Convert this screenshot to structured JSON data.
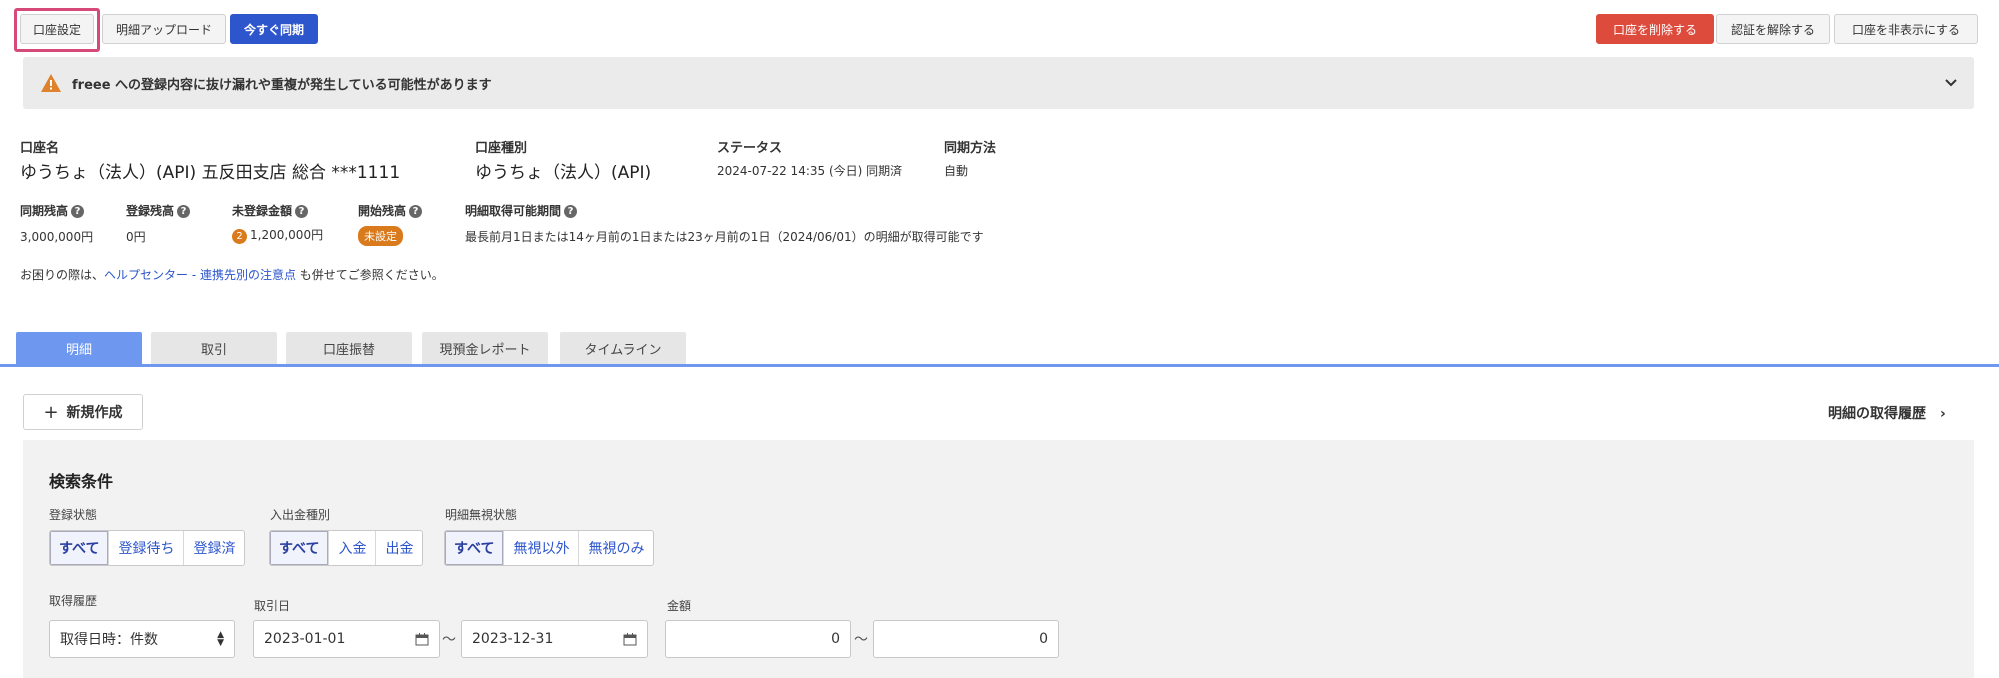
{
  "toolbar": {
    "account_settings": "口座設定",
    "upload_statement": "明細アップロード",
    "sync_now": "今すぐ同期",
    "delete_account": "口座を削除する",
    "revoke_auth": "認証を解除する",
    "hide_account": "口座を非表示にする"
  },
  "alert": {
    "text": "freee への登録内容に抜け漏れや重複が発生している可能性があります"
  },
  "account": {
    "name_label": "口座名",
    "name_value": "ゆうちょ（法人）(API) 五反田支店 総合 ***1111",
    "type_label": "口座種別",
    "type_value": "ゆうちょ（法人）(API)",
    "status_label": "ステータス",
    "status_value": "2024-07-22 14:35 (今日) 同期済",
    "sync_method_label": "同期方法",
    "sync_method_value": "自動"
  },
  "balances": {
    "synced_label": "同期残高",
    "synced_value": "3,000,000円",
    "registered_label": "登録残高",
    "registered_value": "0円",
    "unregistered_label": "未登録金額",
    "unregistered_count": "2",
    "unregistered_value": "1,200,000円",
    "opening_label": "開始残高",
    "opening_value": "未設定",
    "period_label": "明細取得可能期間",
    "period_value": "最長前月1日または14ヶ月前の1日または23ヶ月前の1日（2024/06/01）の明細が取得可能です"
  },
  "help": {
    "prefix": "お困りの際は、",
    "link": "ヘルプセンター - 連携先別の注意点",
    "suffix": " も併せてご参照ください。"
  },
  "tabs": [
    {
      "label": "明細",
      "active": true
    },
    {
      "label": "取引",
      "active": false
    },
    {
      "label": "口座振替",
      "active": false
    },
    {
      "label": "現預金レポート",
      "active": false
    },
    {
      "label": "タイムライン",
      "active": false
    }
  ],
  "new_button": "新規作成",
  "history_link": "明細の取得履歴",
  "search": {
    "title": "検索条件",
    "reg_state_label": "登録状態",
    "reg_state_options": [
      "すべて",
      "登録待ち",
      "登録済"
    ],
    "io_type_label": "入出金種別",
    "io_type_options": [
      "すべて",
      "入金",
      "出金"
    ],
    "ignore_label": "明細無視状態",
    "ignore_options": [
      "すべて",
      "無視以外",
      "無視のみ"
    ],
    "fetch_history_label": "取得履歴",
    "fetch_history_value": "取得日時：件数",
    "txn_date_label": "取引日",
    "date_from": "2023-01-01",
    "date_to": "2023-12-31",
    "amount_label": "金額",
    "amount_from": "0",
    "amount_to": "0",
    "range_sep": "〜"
  },
  "colors": {
    "accent": "#2d55cc",
    "danger": "#dd4b3d",
    "tab_active": "#6e97f0",
    "badge": "#d97a1c"
  }
}
